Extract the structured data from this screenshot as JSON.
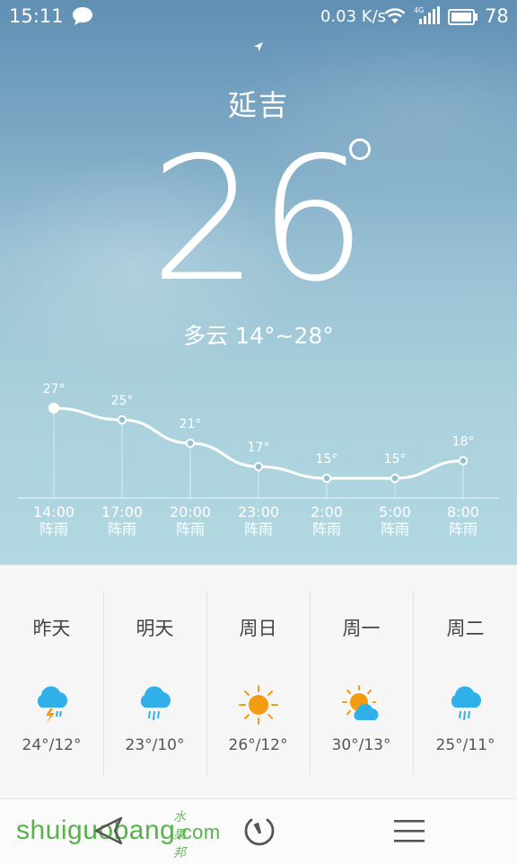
{
  "status_bar": {
    "time": "15:11",
    "net_speed": "0.03 K/s",
    "battery": "78"
  },
  "location": {
    "city": "延吉",
    "current_temp": "26",
    "condition": "多云 14°~28°"
  },
  "chart_data": {
    "type": "line",
    "categories": [
      "14:00",
      "17:00",
      "20:00",
      "23:00",
      "2:00",
      "5:00",
      "8:00"
    ],
    "series": [
      {
        "values": [
          27,
          25,
          21,
          17,
          15,
          15,
          18
        ]
      }
    ],
    "point_labels": [
      "27°",
      "25°",
      "21°",
      "17°",
      "15°",
      "15°",
      "18°"
    ],
    "conditions": [
      "阵雨",
      "阵雨",
      "阵雨",
      "阵雨",
      "阵雨",
      "阵雨",
      "阵雨"
    ],
    "ylim": [
      10,
      30
    ],
    "grid": false
  },
  "forecast": [
    {
      "name": "昨天",
      "icon": "rain-thunder-icon",
      "range": "24°/12°"
    },
    {
      "name": "明天",
      "icon": "rain-icon",
      "range": "23°/10°"
    },
    {
      "name": "周日",
      "icon": "sunny-icon",
      "range": "26°/12°"
    },
    {
      "name": "周一",
      "icon": "partly-cloudy-icon",
      "range": "30°/13°"
    },
    {
      "name": "周二",
      "icon": "rain-icon",
      "range": "25°/11°"
    }
  ],
  "watermark": {
    "text": "shuiguobang",
    "cn": "水果邦",
    "com": ".com"
  },
  "colors": {
    "sky_top": "#5f8fb3",
    "sky_bottom": "#b2d9e2",
    "rain_cloud": "#2fb0e8",
    "sun": "#f39c12"
  }
}
